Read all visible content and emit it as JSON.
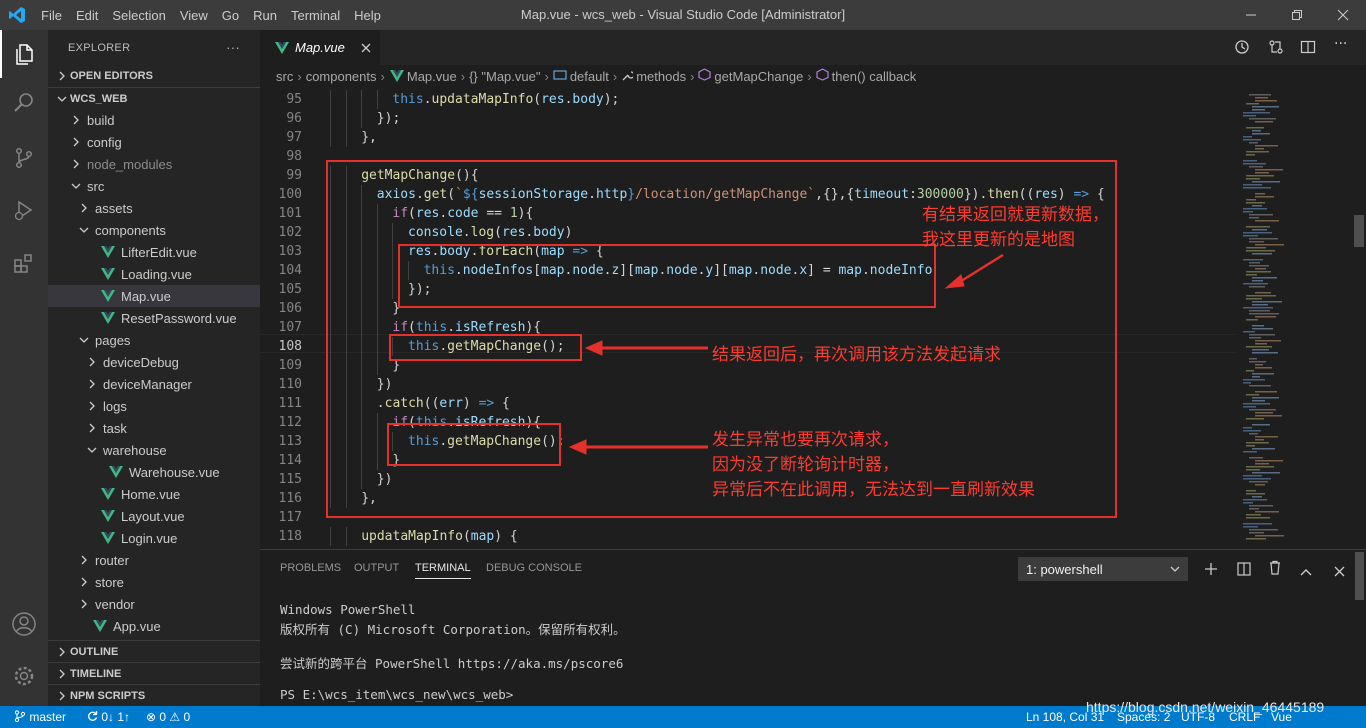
{
  "window": {
    "title": "Map.vue - wcs_web - Visual Studio Code [Administrator]",
    "menu": [
      "File",
      "Edit",
      "Selection",
      "View",
      "Go",
      "Run",
      "Terminal",
      "Help"
    ]
  },
  "sidebar": {
    "header": "EXPLORER",
    "more": "···",
    "open_editors": "OPEN EDITORS",
    "project": "WCS_WEB",
    "tree": [
      {
        "label": "build",
        "depth": 1,
        "type": "folder",
        "open": false
      },
      {
        "label": "config",
        "depth": 1,
        "type": "folder",
        "open": false
      },
      {
        "label": "node_modules",
        "depth": 1,
        "type": "folder",
        "open": false,
        "dim": true
      },
      {
        "label": "src",
        "depth": 1,
        "type": "folder",
        "open": true
      },
      {
        "label": "assets",
        "depth": 2,
        "type": "folder",
        "open": false
      },
      {
        "label": "components",
        "depth": 2,
        "type": "folder",
        "open": true
      },
      {
        "label": "LifterEdit.vue",
        "depth": 3,
        "type": "vue"
      },
      {
        "label": "Loading.vue",
        "depth": 3,
        "type": "vue"
      },
      {
        "label": "Map.vue",
        "depth": 3,
        "type": "vue",
        "selected": true
      },
      {
        "label": "ResetPassword.vue",
        "depth": 3,
        "type": "vue"
      },
      {
        "label": "pages",
        "depth": 2,
        "type": "folder",
        "open": true
      },
      {
        "label": "deviceDebug",
        "depth": 3,
        "type": "folder",
        "open": false
      },
      {
        "label": "deviceManager",
        "depth": 3,
        "type": "folder",
        "open": false
      },
      {
        "label": "logs",
        "depth": 3,
        "type": "folder",
        "open": false
      },
      {
        "label": "task",
        "depth": 3,
        "type": "folder",
        "open": false
      },
      {
        "label": "warehouse",
        "depth": 3,
        "type": "folder",
        "open": true
      },
      {
        "label": "Warehouse.vue",
        "depth": 4,
        "type": "vue"
      },
      {
        "label": "Home.vue",
        "depth": 3,
        "type": "vue"
      },
      {
        "label": "Layout.vue",
        "depth": 3,
        "type": "vue"
      },
      {
        "label": "Login.vue",
        "depth": 3,
        "type": "vue"
      },
      {
        "label": "router",
        "depth": 2,
        "type": "folder",
        "open": false
      },
      {
        "label": "store",
        "depth": 2,
        "type": "folder",
        "open": false
      },
      {
        "label": "vendor",
        "depth": 2,
        "type": "folder",
        "open": false
      },
      {
        "label": "App.vue",
        "depth": 2,
        "type": "vue"
      }
    ],
    "outline": "OUTLINE",
    "timeline": "TIMELINE",
    "npm": "NPM SCRIPTS"
  },
  "editor": {
    "tab": "Map.vue",
    "breadcrumb": [
      "src",
      "components",
      "Map.vue",
      "{} \"Map.vue\"",
      "default",
      "methods",
      "getMapChange",
      "then() callback"
    ],
    "lines": [
      {
        "n": "95",
        "i": 4,
        "t": [
          [
            "k",
            "this"
          ],
          [
            "p",
            "."
          ],
          [
            "f",
            "updataMapInfo"
          ],
          [
            "p",
            "("
          ],
          [
            "v",
            "res"
          ],
          [
            "p",
            "."
          ],
          [
            "v",
            "body"
          ],
          [
            "p",
            ");"
          ]
        ]
      },
      {
        "n": "96",
        "i": 3,
        "t": [
          [
            "p",
            "});"
          ]
        ]
      },
      {
        "n": "97",
        "i": 2,
        "t": [
          [
            "p",
            "},"
          ]
        ]
      },
      {
        "n": "98",
        "i": 0,
        "t": []
      },
      {
        "n": "99",
        "i": 2,
        "t": [
          [
            "f",
            "getMapChange"
          ],
          [
            "p",
            "(){"
          ]
        ]
      },
      {
        "n": "100",
        "i": 3,
        "t": [
          [
            "v",
            "axios"
          ],
          [
            "p",
            "."
          ],
          [
            "f",
            "get"
          ],
          [
            "p",
            "("
          ],
          [
            "s",
            "`"
          ],
          [
            "k",
            "${"
          ],
          [
            "v",
            "sessionStorage"
          ],
          [
            "p",
            "."
          ],
          [
            "v",
            "http"
          ],
          [
            "k",
            "}"
          ],
          [
            "s",
            "/location/getMapChange`"
          ],
          [
            "p",
            ",{},{"
          ],
          [
            "v",
            "timeout"
          ],
          [
            "p",
            ":"
          ],
          [
            "n",
            "300000"
          ],
          [
            "p",
            "})."
          ],
          [
            "f",
            "then"
          ],
          [
            "p",
            "(("
          ],
          [
            "v",
            "res"
          ],
          [
            "p",
            ") "
          ],
          [
            "k",
            "=>"
          ],
          [
            "p",
            " {"
          ]
        ]
      },
      {
        "n": "101",
        "i": 4,
        "t": [
          [
            "c",
            "if"
          ],
          [
            "p",
            "("
          ],
          [
            "v",
            "res"
          ],
          [
            "p",
            "."
          ],
          [
            "v",
            "code"
          ],
          [
            "p",
            " == "
          ],
          [
            "n",
            "1"
          ],
          [
            "p",
            "){"
          ]
        ]
      },
      {
        "n": "102",
        "i": 5,
        "t": [
          [
            "v",
            "console"
          ],
          [
            "p",
            "."
          ],
          [
            "f",
            "log"
          ],
          [
            "p",
            "("
          ],
          [
            "v",
            "res"
          ],
          [
            "p",
            "."
          ],
          [
            "v",
            "body"
          ],
          [
            "p",
            ")"
          ]
        ]
      },
      {
        "n": "103",
        "i": 5,
        "t": [
          [
            "v",
            "res"
          ],
          [
            "p",
            "."
          ],
          [
            "v",
            "body"
          ],
          [
            "p",
            "."
          ],
          [
            "f",
            "forEach"
          ],
          [
            "p",
            "("
          ],
          [
            "v",
            "map"
          ],
          [
            "p",
            " "
          ],
          [
            "k",
            "=>"
          ],
          [
            "p",
            " {"
          ]
        ]
      },
      {
        "n": "104",
        "i": 6,
        "t": [
          [
            "k",
            "this"
          ],
          [
            "p",
            "."
          ],
          [
            "v",
            "nodeInfos"
          ],
          [
            "p",
            "["
          ],
          [
            "v",
            "map"
          ],
          [
            "p",
            "."
          ],
          [
            "v",
            "node"
          ],
          [
            "p",
            "."
          ],
          [
            "v",
            "z"
          ],
          [
            "p",
            "]["
          ],
          [
            "v",
            "map"
          ],
          [
            "p",
            "."
          ],
          [
            "v",
            "node"
          ],
          [
            "p",
            "."
          ],
          [
            "v",
            "y"
          ],
          [
            "p",
            "]["
          ],
          [
            "v",
            "map"
          ],
          [
            "p",
            "."
          ],
          [
            "v",
            "node"
          ],
          [
            "p",
            "."
          ],
          [
            "v",
            "x"
          ],
          [
            "p",
            "] = "
          ],
          [
            "v",
            "map"
          ],
          [
            "p",
            "."
          ],
          [
            "v",
            "nodeInfo"
          ]
        ]
      },
      {
        "n": "105",
        "i": 5,
        "t": [
          [
            "p",
            "});"
          ]
        ]
      },
      {
        "n": "106",
        "i": 4,
        "t": [
          [
            "p",
            "}"
          ]
        ]
      },
      {
        "n": "107",
        "i": 4,
        "t": [
          [
            "c",
            "if"
          ],
          [
            "p",
            "("
          ],
          [
            "k",
            "this"
          ],
          [
            "p",
            "."
          ],
          [
            "v",
            "isRefresh"
          ],
          [
            "p",
            "){"
          ]
        ]
      },
      {
        "n": "108",
        "i": 5,
        "t": [
          [
            "k",
            "this"
          ],
          [
            "p",
            "."
          ],
          [
            "f",
            "getMapChange"
          ],
          [
            "p",
            "();"
          ]
        ],
        "current": true
      },
      {
        "n": "109",
        "i": 4,
        "t": [
          [
            "p",
            "}"
          ]
        ]
      },
      {
        "n": "110",
        "i": 3,
        "t": [
          [
            "p",
            "})"
          ]
        ]
      },
      {
        "n": "111",
        "i": 3,
        "t": [
          [
            "p",
            "."
          ],
          [
            "f",
            "catch"
          ],
          [
            "p",
            "(("
          ],
          [
            "v",
            "err"
          ],
          [
            "p",
            ") "
          ],
          [
            "k",
            "=>"
          ],
          [
            "p",
            " {"
          ]
        ]
      },
      {
        "n": "112",
        "i": 4,
        "t": [
          [
            "c",
            "if"
          ],
          [
            "p",
            "("
          ],
          [
            "k",
            "this"
          ],
          [
            "p",
            "."
          ],
          [
            "v",
            "isRefresh"
          ],
          [
            "p",
            "){"
          ]
        ]
      },
      {
        "n": "113",
        "i": 5,
        "t": [
          [
            "k",
            "this"
          ],
          [
            "p",
            "."
          ],
          [
            "f",
            "getMapChange"
          ],
          [
            "p",
            "();"
          ]
        ]
      },
      {
        "n": "114",
        "i": 4,
        "t": [
          [
            "p",
            "}"
          ]
        ]
      },
      {
        "n": "115",
        "i": 3,
        "t": [
          [
            "p",
            "})"
          ]
        ]
      },
      {
        "n": "116",
        "i": 2,
        "t": [
          [
            "p",
            "},"
          ]
        ]
      },
      {
        "n": "117",
        "i": 0,
        "t": []
      },
      {
        "n": "118",
        "i": 2,
        "t": [
          [
            "f",
            "updataMapInfo"
          ],
          [
            "p",
            "("
          ],
          [
            "v",
            "map"
          ],
          [
            "p",
            ") {"
          ]
        ]
      }
    ],
    "annotations": {
      "a1": "有结果返回就更新数据，\n我这里更新的是地图",
      "a2": "结果返回后，再次调用该方法发起请求",
      "a3": "发生异常也要再次请求，\n因为没了断轮询计时器，\n异常后不在此调用，无法达到一直刷新效果"
    }
  },
  "panel": {
    "tabs": [
      "PROBLEMS",
      "OUTPUT",
      "TERMINAL",
      "DEBUG CONSOLE"
    ],
    "active_tab": "TERMINAL",
    "terminal_select": "1: powershell",
    "terminal_lines": [
      "Windows PowerShell",
      "版权所有 (C) Microsoft Corporation。保留所有权利。",
      "",
      "尝试新的跨平台 PowerShell https://aka.ms/pscore6",
      "",
      "PS E:\\wcs_item\\wcs_new\\wcs_web>"
    ]
  },
  "statusbar": {
    "branch": "master",
    "sync": "0↓ 1↑",
    "problems": "⊗ 0 ⚠ 0",
    "cursor": "Ln 108, Col 31",
    "spaces": "Spaces: 2",
    "encoding": "UTF-8",
    "eol": "CRLF",
    "language": "Vue"
  },
  "watermark": "https://blog.csdn.net/weixin_46445189",
  "colors": {
    "accent": "#007acc",
    "annotation": "#e5312b",
    "vue": "#41b883"
  }
}
